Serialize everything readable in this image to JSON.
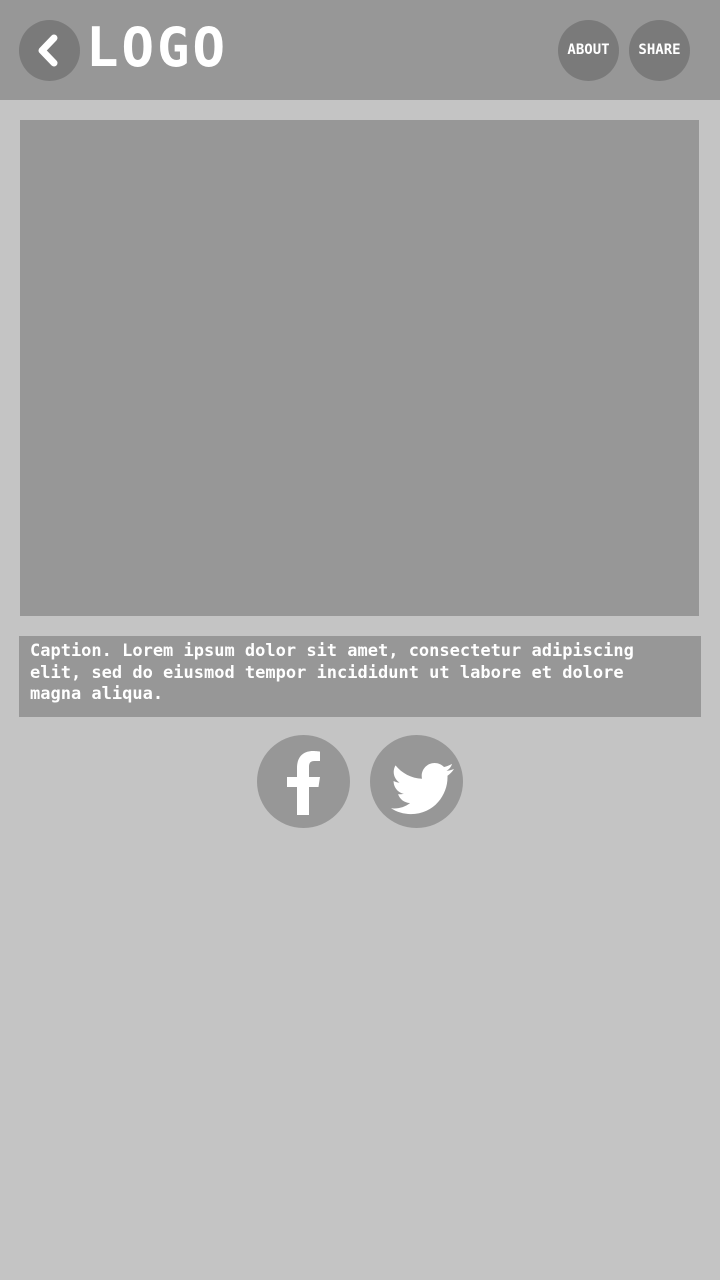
{
  "header": {
    "logo_text": "LOGO",
    "back_icon": "chevron-left-icon",
    "about_label": "ABOUT",
    "share_label": "SHARE"
  },
  "main": {
    "image": "placeholder-image",
    "caption": "Caption. Lorem ipsum dolor sit amet, consectetur adipiscing\nelit, sed do eiusmod tempor incididunt ut labore et dolore\nmagna aliqua."
  },
  "social": {
    "facebook_icon": "facebook-icon",
    "twitter_icon": "twitter-icon"
  },
  "colors": {
    "background": "#c4c4c4",
    "panel": "#979797",
    "button_dark": "#7a7a7a",
    "text": "#ffffff"
  }
}
